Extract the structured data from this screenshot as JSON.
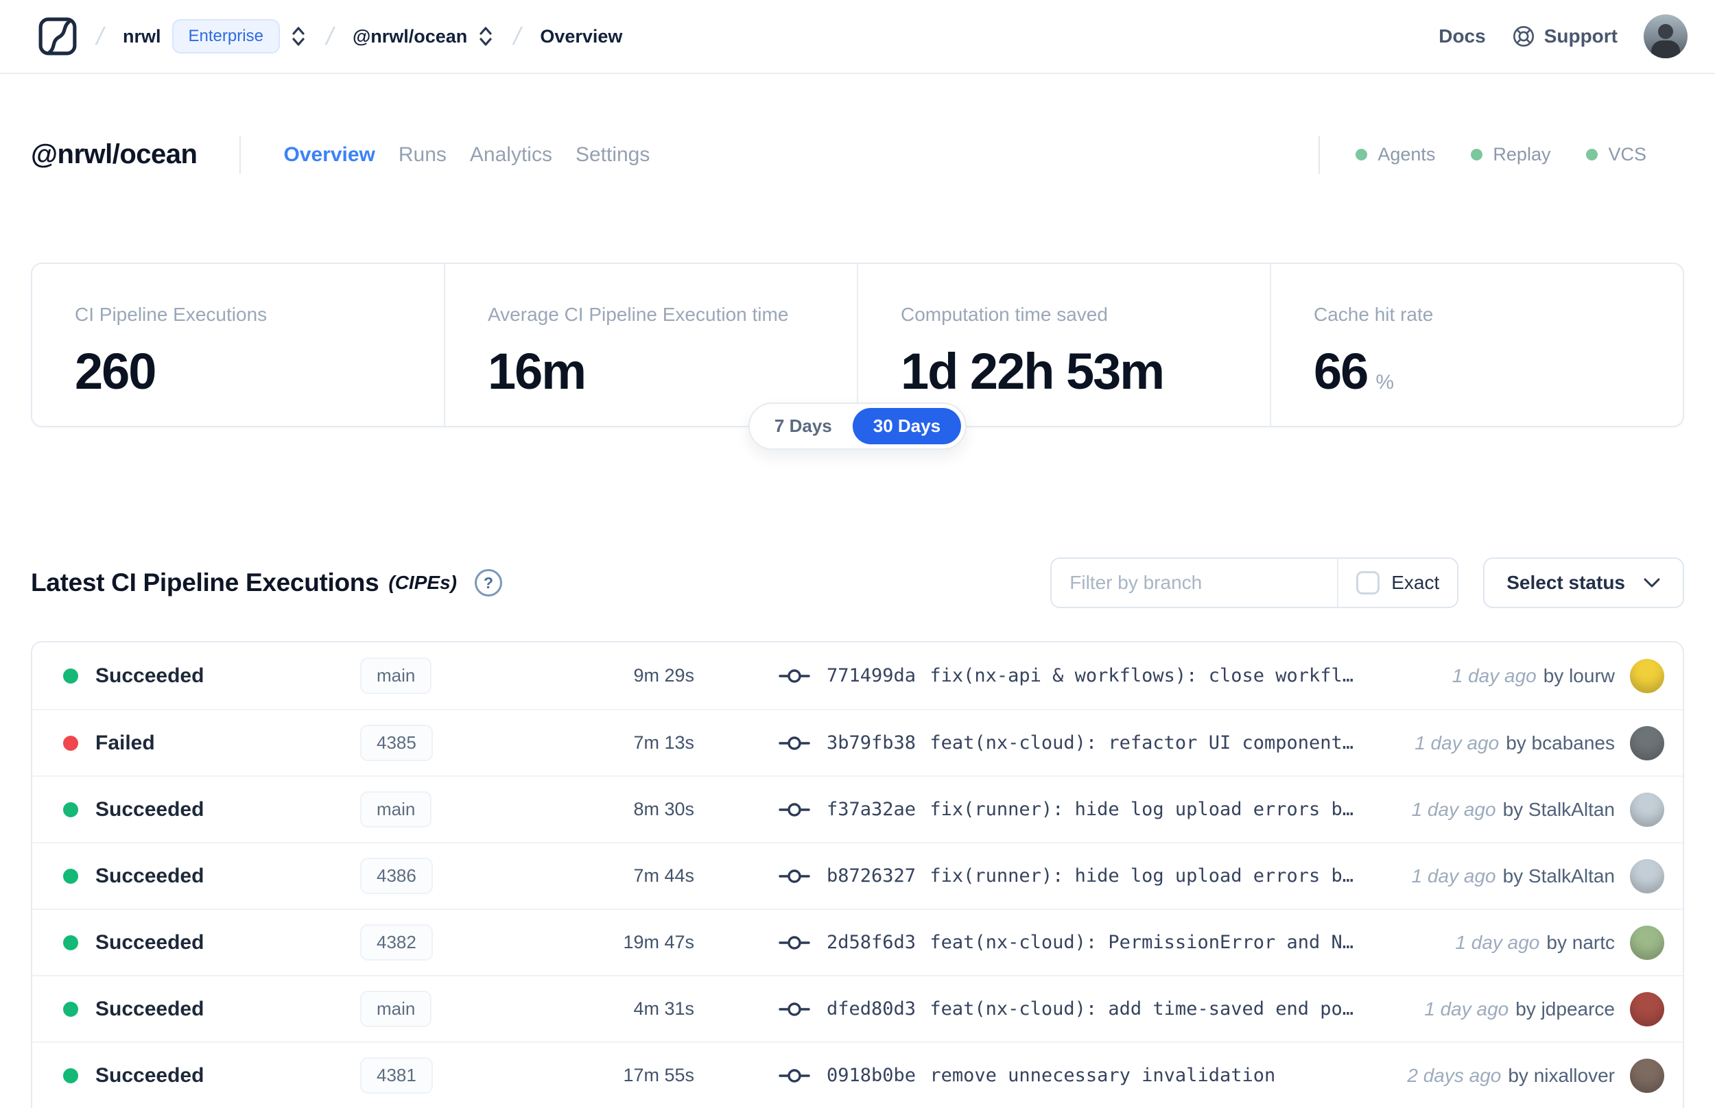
{
  "colors": {
    "accent_blue": "#2563eb",
    "tab_active": "#3b82f6",
    "enterprise_text": "#2f6bdf",
    "feature_dot": "#7cc79e",
    "status": {
      "green": "#14b877",
      "red": "#f0474c"
    }
  },
  "header": {
    "crumb_org": "nrwl",
    "crumb_badge": "Enterprise",
    "crumb_workspace": "@nrwl/ocean",
    "crumb_page": "Overview",
    "docs_label": "Docs",
    "support_label": "Support"
  },
  "workspace": {
    "title": "@nrwl/ocean",
    "tabs": [
      {
        "label": "Overview"
      },
      {
        "label": "Runs"
      },
      {
        "label": "Analytics"
      },
      {
        "label": "Settings"
      }
    ],
    "features": [
      {
        "label": "Agents"
      },
      {
        "label": "Replay"
      },
      {
        "label": "VCS"
      }
    ]
  },
  "stats": {
    "cards": [
      {
        "label": "CI Pipeline Executions",
        "value": "260",
        "suffix": ""
      },
      {
        "label": "Average CI Pipeline Execution time",
        "value": "16m",
        "suffix": ""
      },
      {
        "label": "Computation time saved",
        "value": "1d 22h 53m",
        "suffix": ""
      },
      {
        "label": "Cache hit rate",
        "value": "66",
        "suffix": "%"
      }
    ],
    "range": [
      {
        "label": "7 Days"
      },
      {
        "label": "30 Days"
      }
    ],
    "range_selected": "30 Days"
  },
  "cipe_section": {
    "title": "Latest CI Pipeline Executions",
    "title_suffix": "(CIPEs)",
    "help_glyph": "?",
    "filter_placeholder": "Filter by branch",
    "exact_label": "Exact",
    "status_select_label": "Select status",
    "rows": [
      {
        "status": "Succeeded",
        "status_color": "green",
        "branch": "main",
        "duration": "9m 29s",
        "commit_hash": "771499da",
        "commit_message": "fix(nx-api & workflows): close workfl…",
        "time": "1 day ago",
        "author": "by lourw",
        "avatar_color": "#f0cf3a"
      },
      {
        "status": "Failed",
        "status_color": "red",
        "branch": "4385",
        "duration": "7m 13s",
        "commit_hash": "3b79fb38",
        "commit_message": "feat(nx-cloud): refactor UI component…",
        "time": "1 day ago",
        "author": "by bcabanes",
        "avatar_color": "#6d7478"
      },
      {
        "status": "Succeeded",
        "status_color": "green",
        "branch": "main",
        "duration": "8m 30s",
        "commit_hash": "f37a32ae",
        "commit_message": "fix(runner): hide log upload errors b…",
        "time": "1 day ago",
        "author": "by StalkAltan",
        "avatar_color": "#c3ced6"
      },
      {
        "status": "Succeeded",
        "status_color": "green",
        "branch": "4386",
        "duration": "7m 44s",
        "commit_hash": "b8726327",
        "commit_message": "fix(runner): hide log upload errors b…",
        "time": "1 day ago",
        "author": "by StalkAltan",
        "avatar_color": "#c3ced6"
      },
      {
        "status": "Succeeded",
        "status_color": "green",
        "branch": "4382",
        "duration": "19m 47s",
        "commit_hash": "2d58f6d3",
        "commit_message": "feat(nx-cloud): PermissionError and N…",
        "time": "1 day ago",
        "author": "by nartc",
        "avatar_color": "#9cb989"
      },
      {
        "status": "Succeeded",
        "status_color": "green",
        "branch": "main",
        "duration": "4m 31s",
        "commit_hash": "dfed80d3",
        "commit_message": "feat(nx-cloud): add time-saved end po…",
        "time": "1 day ago",
        "author": "by jdpearce",
        "avatar_color": "#a84b43"
      },
      {
        "status": "Succeeded",
        "status_color": "green",
        "branch": "4381",
        "duration": "17m 55s",
        "commit_hash": "0918b0be",
        "commit_message": "remove unnecessary invalidation",
        "time": "2 days ago",
        "author": "by nixallover",
        "avatar_color": "#7d6a60"
      }
    ]
  }
}
